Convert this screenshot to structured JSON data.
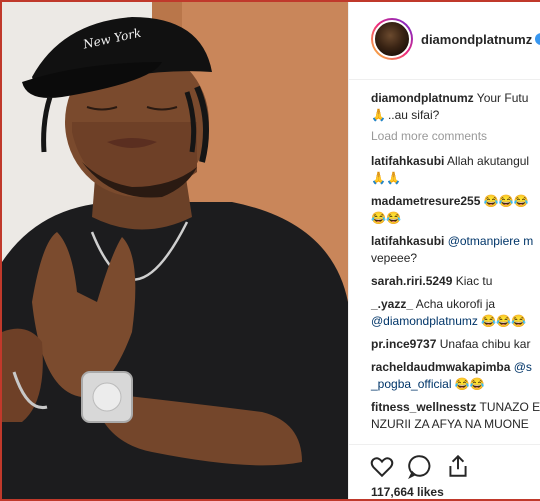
{
  "post": {
    "author": "diamondplatnumz",
    "caption_text": "Your Futu",
    "caption_line2": "..au sifai?",
    "load_more": "Load more comments",
    "likes": "117,664 likes"
  },
  "comments": [
    {
      "user": "latifahkasubi",
      "text": "Allah akutangul",
      "line2": "🙏🙏"
    },
    {
      "user": "madametresure255",
      "text": "😂😂😂",
      "line2": "😂😂"
    },
    {
      "user": "latifahkasubi",
      "text": "@otmanpiere m",
      "line2": "vepeee?"
    },
    {
      "user": "sarah.riri.5249",
      "text": "Kiac tu"
    },
    {
      "user": "_.yazz_",
      "text": "Acha ukorofi ja",
      "line2": "@diamondplatnumz 😂😂😂"
    },
    {
      "user": "pr.ince9737",
      "text": "Unafaa chibu kar"
    },
    {
      "user": "racheldaudmwakapimba",
      "text": "@s",
      "line2": "_pogba_official 😂😂"
    },
    {
      "user": "fitness_wellnesstz",
      "text": "TUNAZO E",
      "line2": "NZURII ZA AFYA NA MUONE"
    }
  ],
  "photo": {
    "cap_text": "New York"
  },
  "icons": [
    "heart-icon",
    "comment-icon",
    "share-icon"
  ],
  "colors": {
    "accent": "#3897f0",
    "frame": "#c0392b"
  }
}
